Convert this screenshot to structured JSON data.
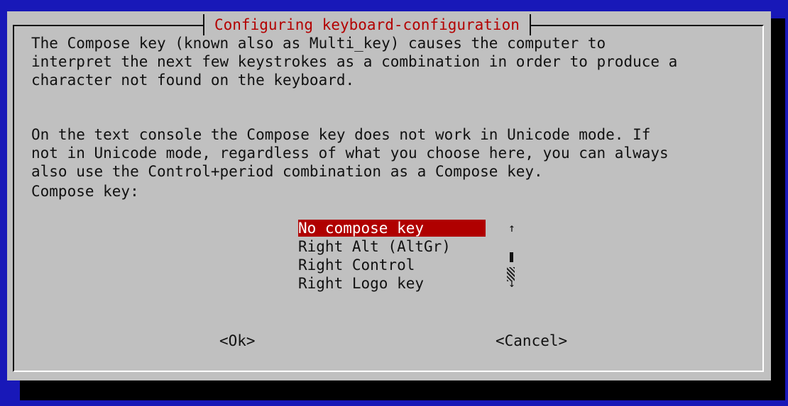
{
  "dialog": {
    "title": "Configuring keyboard-configuration",
    "paragraph1": [
      "The Compose key (known also as Multi_key) causes the computer to",
      "interpret the next few keystrokes as a combination in order to produce a",
      "character not found on the keyboard."
    ],
    "paragraph2": [
      "On the text console the Compose key does not work in Unicode mode. If",
      "not in Unicode mode, regardless of what you choose here, you can always",
      "also use the Control+period combination as a Compose key."
    ],
    "prompt": "Compose key:",
    "options": [
      "No compose key",
      "Right Alt (AltGr)",
      "Right Control",
      "Right Logo key"
    ],
    "selected_index": 0,
    "scroll_up": "↑",
    "scroll_down": "↓",
    "ok_label": "<Ok>",
    "cancel_label": "<Cancel>"
  },
  "colors": {
    "background": "#1818b8",
    "dialog": "#c0c0c0",
    "title_text": "#b30000",
    "selection": "#b00000"
  }
}
